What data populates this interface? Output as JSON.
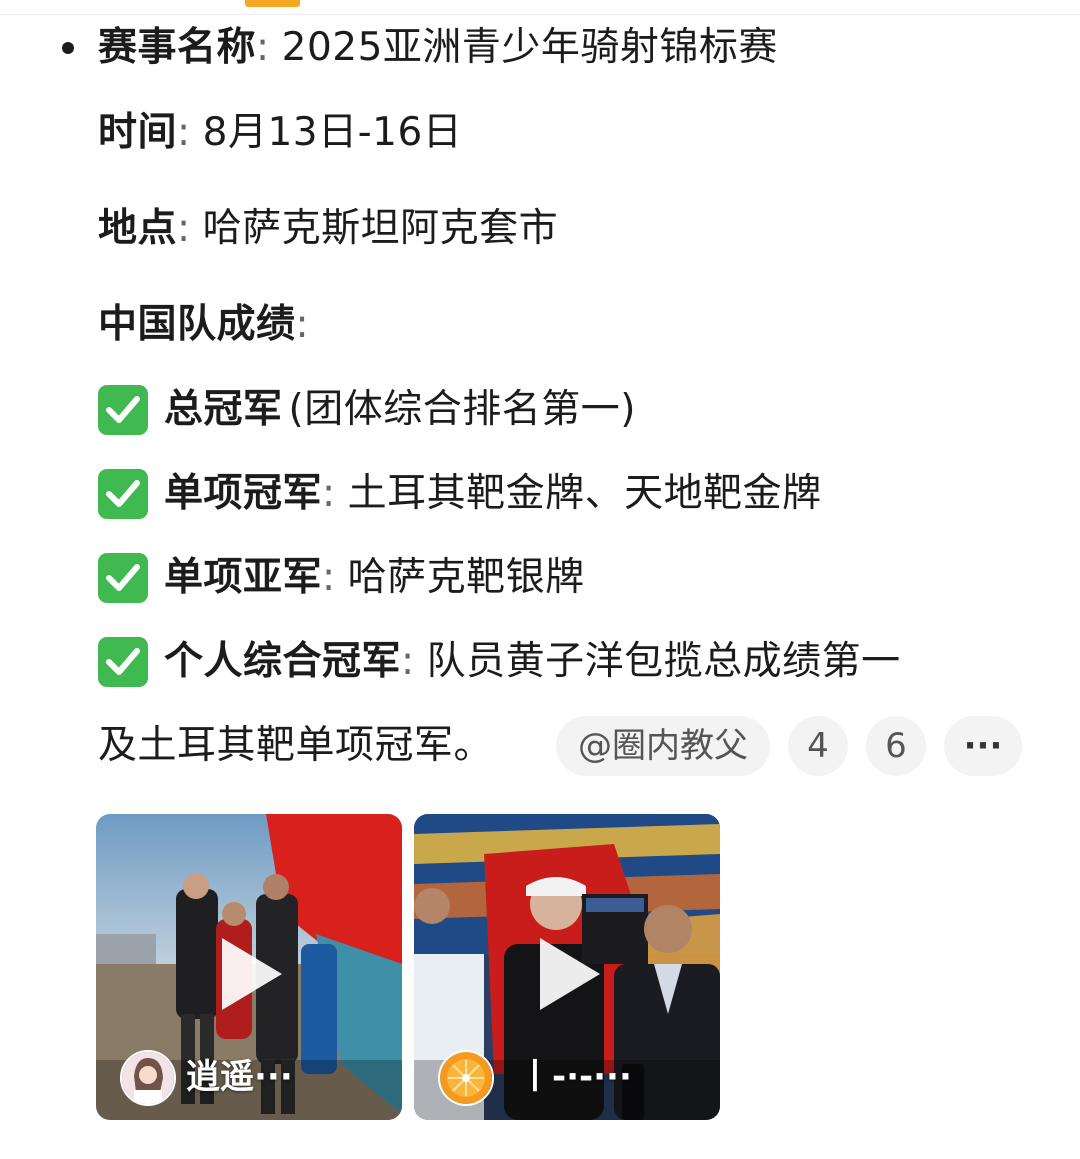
{
  "event": {
    "name_label": "赛事名称",
    "name_value": "2025亚洲青少年骑射锦标赛",
    "time_label": "时间",
    "time_value": "8月13日-16日",
    "place_label": "地点",
    "place_value": "哈萨克斯坦阿克套市",
    "results_label": "中国队成绩",
    "colon": ":"
  },
  "results": [
    {
      "label": "总冠军",
      "value": "(团体综合排名第一)"
    },
    {
      "label": "单项冠军",
      "value": "土耳其靶金牌、天地靶金牌"
    },
    {
      "label": "单项亚军",
      "value": "哈萨克靶银牌"
    },
    {
      "label": "个人综合冠军",
      "value": "队员黄子洋包揽总成绩第一"
    }
  ],
  "continuation": "及土耳其靶单项冠军。",
  "actions": {
    "mention": "@圈内教父",
    "count_a": "4",
    "count_b": "6",
    "more": "···"
  },
  "videos": [
    {
      "author": "逍遥···"
    },
    {
      "author": "丨-·-···"
    }
  ],
  "colors": {
    "check_green": "#3fb950",
    "accent_tab": "#f5a623"
  },
  "icons": [
    "check-mark-icon",
    "more-icon",
    "play-icon"
  ]
}
